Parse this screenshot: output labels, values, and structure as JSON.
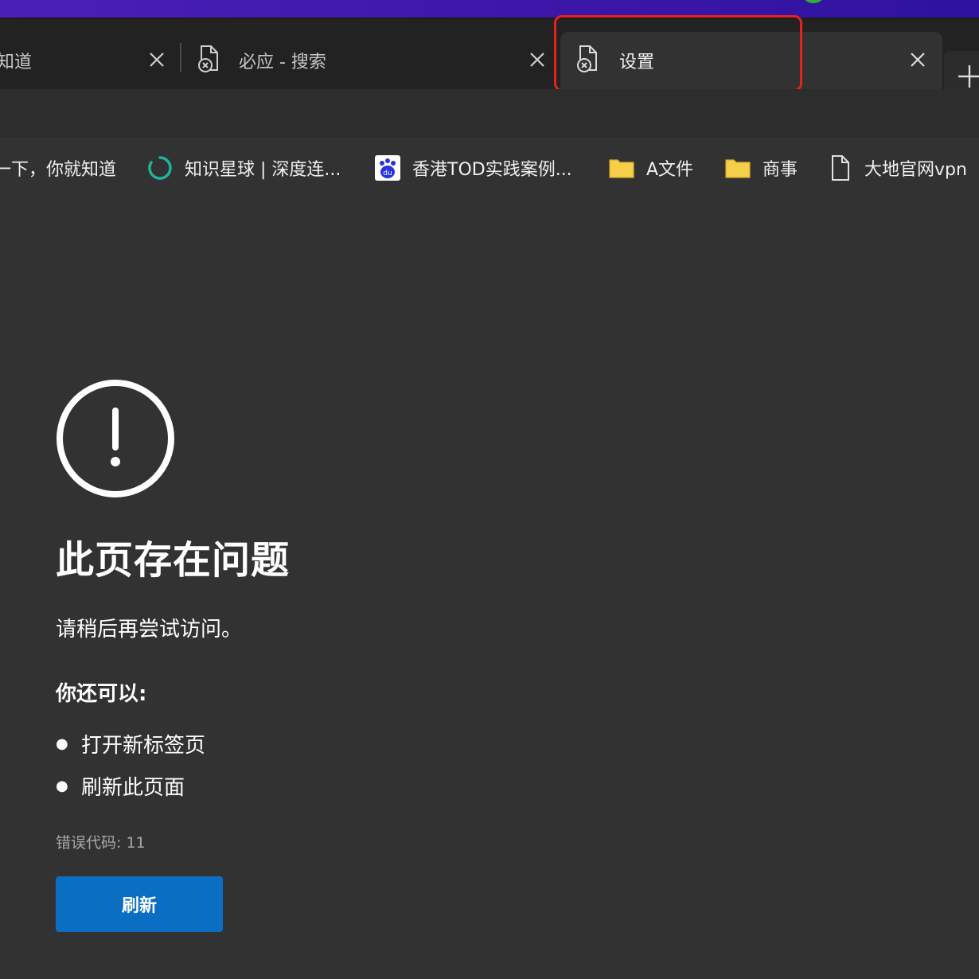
{
  "tabs": [
    {
      "label": "知道",
      "active": false
    },
    {
      "label": "必应 - 搜索",
      "active": false
    },
    {
      "label": "设置",
      "active": true
    }
  ],
  "favorites": [
    {
      "label": "一下，你就知道",
      "icon": "none"
    },
    {
      "label": "知识星球 | 深度连...",
      "icon": "zsxq-icon"
    },
    {
      "label": "香港TOD实践案例...",
      "icon": "baidu-icon"
    },
    {
      "label": "A文件",
      "icon": "folder-icon"
    },
    {
      "label": "商事",
      "icon": "folder-icon"
    },
    {
      "label": "大地官网vpn",
      "icon": "page-icon"
    }
  ],
  "error": {
    "title": "此页存在问题",
    "subtitle": "请稍后再尝试访问。",
    "also_label": "你还可以:",
    "suggestions": [
      "打开新标签页",
      "刷新此页面"
    ],
    "code": "错误代码: 11",
    "button_label": "刷新"
  },
  "colors": {
    "accent": "#0a6fc2",
    "highlight": "#e5231b",
    "page_bg": "#323232",
    "folder": "#f6cf4a"
  }
}
